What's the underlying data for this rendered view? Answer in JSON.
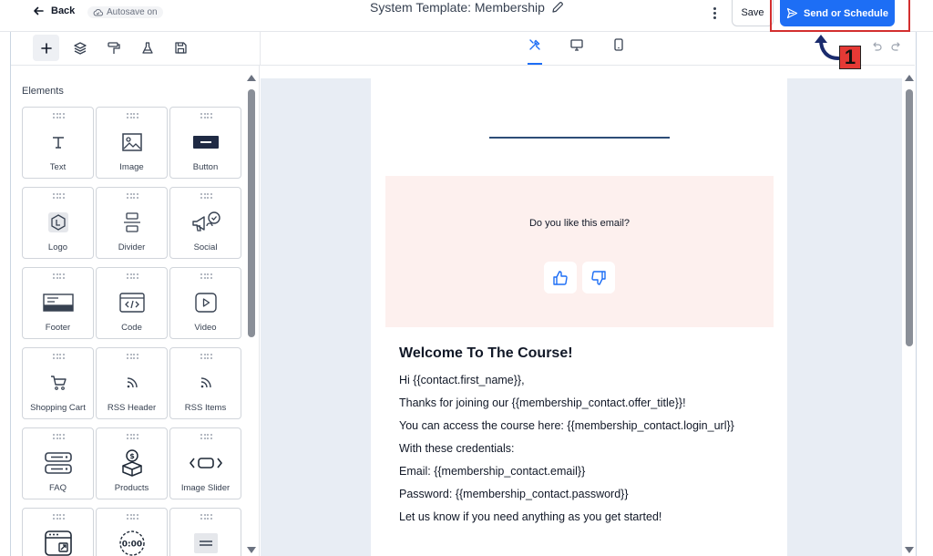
{
  "header": {
    "back_label": "Back",
    "autosave_label": "Autosave on",
    "title": "System Template: Membership",
    "save_label": "Save",
    "send_label": "Send or Schedule",
    "annotation_number": "1"
  },
  "toolbar": {
    "left_tools": [
      "add-icon",
      "layers-icon",
      "paint-roller-icon",
      "flask-icon",
      "floppy-disk-icon"
    ],
    "center_tools": [
      "tools-icon",
      "desktop-icon",
      "mobile-icon"
    ],
    "right_tools": [
      "undo-icon",
      "redo-icon"
    ]
  },
  "sidebar": {
    "heading": "Elements",
    "elements": [
      {
        "label": "Text",
        "icon": "text-icon"
      },
      {
        "label": "Image",
        "icon": "image-icon"
      },
      {
        "label": "Button",
        "icon": "button-icon"
      },
      {
        "label": "Logo",
        "icon": "logo-icon"
      },
      {
        "label": "Divider",
        "icon": "divider-icon"
      },
      {
        "label": "Social",
        "icon": "social-icon"
      },
      {
        "label": "Footer",
        "icon": "footer-icon"
      },
      {
        "label": "Code",
        "icon": "code-icon"
      },
      {
        "label": "Video",
        "icon": "video-icon"
      },
      {
        "label": "Shopping Cart",
        "icon": "cart-icon"
      },
      {
        "label": "RSS Header",
        "icon": "rss-icon"
      },
      {
        "label": "RSS Items",
        "icon": "rss-icon"
      },
      {
        "label": "FAQ",
        "icon": "faq-icon"
      },
      {
        "label": "Products",
        "icon": "products-icon"
      },
      {
        "label": "Image Slider",
        "icon": "slider-icon"
      },
      {
        "label": "",
        "icon": "browser-icon"
      },
      {
        "label": "",
        "icon": "countdown-icon"
      },
      {
        "label": "",
        "icon": "menu-icon"
      }
    ],
    "countdown_text": "0:00"
  },
  "email": {
    "feedback_question": "Do you like this email?",
    "heading": "Welcome To The Course!",
    "lines": [
      "Hi {{contact.first_name}},",
      "Thanks for joining our {{membership_contact.offer_title}}!",
      "You can access the course here: {{membership_contact.login_url}}",
      "With these credentials:",
      "Email: {{membership_contact.email}}",
      "Password: {{membership_contact.password}}",
      "Let us know if you need anything as you get started!"
    ]
  },
  "colors": {
    "primary": "#1d6ef5",
    "highlight": "#d32f2f",
    "feedback_bg": "#fdf0ee",
    "canvas_bg": "#e8edf4"
  }
}
